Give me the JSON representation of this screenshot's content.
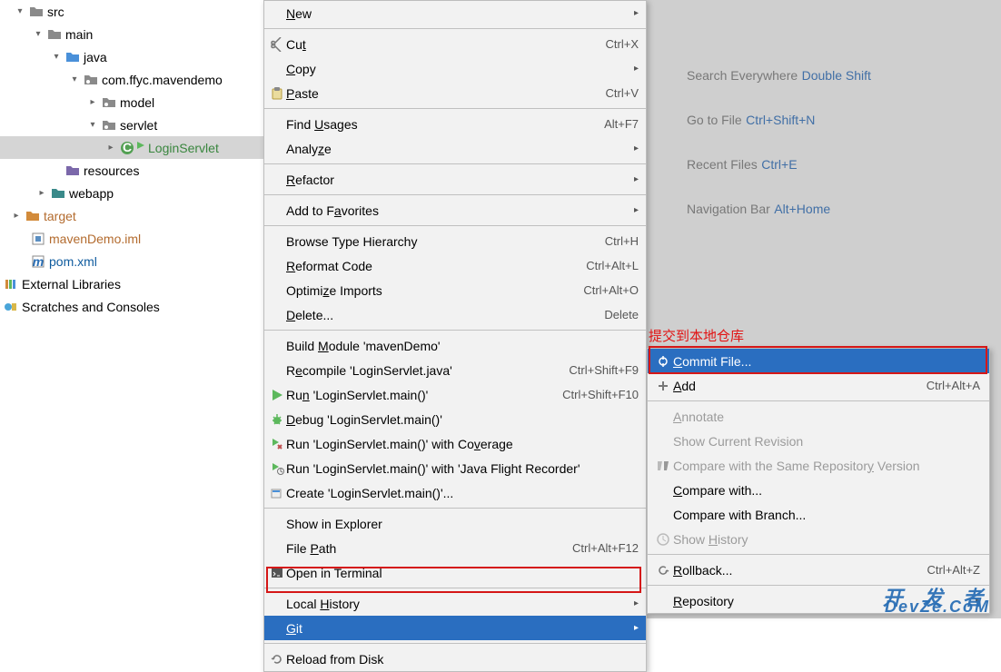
{
  "tree": {
    "src": "src",
    "main": "main",
    "java": "java",
    "pkg": "com.ffyc.mavendemo",
    "model": "model",
    "servlet": "servlet",
    "login": "LoginServlet",
    "resources": "resources",
    "webapp": "webapp",
    "target": "target",
    "iml": "mavenDemo.iml",
    "pom": "pom.xml",
    "extlib": "External Libraries",
    "scratch": "Scratches and Consoles"
  },
  "menu": {
    "new": "New",
    "cut": "Cut",
    "cut_sc": "Ctrl+X",
    "copy": "Copy",
    "paste": "Paste",
    "paste_sc": "Ctrl+V",
    "findUsages": "Find Usages",
    "findUsages_sc": "Alt+F7",
    "analyze": "Analyze",
    "refactor": "Refactor",
    "addFav": "Add to Favorites",
    "browseHier": "Browse Type Hierarchy",
    "browseHier_sc": "Ctrl+H",
    "reformat": "Reformat Code",
    "reformat_sc": "Ctrl+Alt+L",
    "optImp": "Optimize Imports",
    "optImp_sc": "Ctrl+Alt+O",
    "delete": "Delete...",
    "delete_sc": "Delete",
    "buildMod": "Build Module 'mavenDemo'",
    "recompile": "Recompile 'LoginServlet.java'",
    "recompile_sc": "Ctrl+Shift+F9",
    "run": "Run 'LoginServlet.main()'",
    "run_sc": "Ctrl+Shift+F10",
    "debug": "Debug 'LoginServlet.main()'",
    "coverage": "Run 'LoginServlet.main()' with Coverage",
    "jfr": "Run 'LoginServlet.main()' with 'Java Flight Recorder'",
    "createRun": "Create 'LoginServlet.main()'...",
    "showExplorer": "Show in Explorer",
    "filePath": "File Path",
    "filePath_sc": "Ctrl+Alt+F12",
    "openTerm": "Open in Terminal",
    "localHist": "Local History",
    "git": "Git",
    "reload": "Reload from Disk"
  },
  "sub": {
    "commit": "Commit File...",
    "add": "Add",
    "add_sc": "Ctrl+Alt+A",
    "annotate": "Annotate",
    "showRev": "Show Current Revision",
    "compareSame": "Compare with the Same Repository Version",
    "compareWith": "Compare with...",
    "compareBranch": "Compare with Branch...",
    "showHist": "Show History",
    "rollback": "Rollback...",
    "rollback_sc": "Ctrl+Alt+Z",
    "repo": "Repository"
  },
  "hints": {
    "se": "Search Everywhere",
    "se_k": "Double Shift",
    "gf": "Go to File",
    "gf_k": "Ctrl+Shift+N",
    "rf": "Recent Files",
    "rf_k": "Ctrl+E",
    "nb": "Navigation Bar",
    "nb_k": "Alt+Home"
  },
  "annotation": "提交到本地仓库",
  "watermark1": "开 发 者",
  "watermark2": "DevZe.CoM"
}
